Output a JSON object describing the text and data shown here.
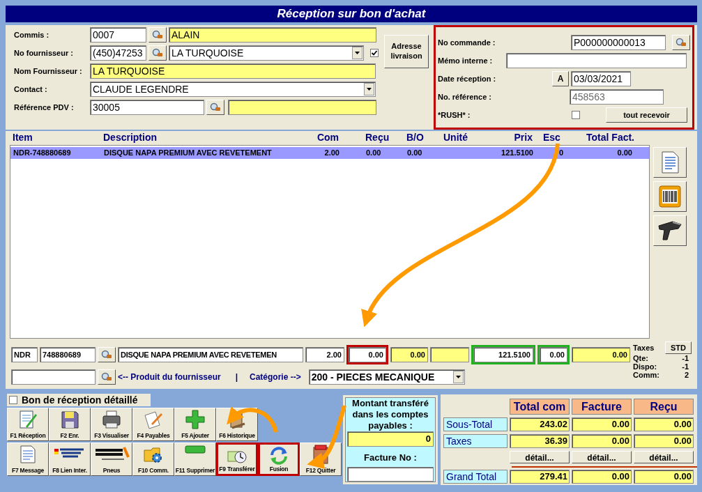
{
  "window": {
    "title": "Réception sur bon d'achat"
  },
  "header_form": {
    "commis": {
      "label": "Commis :",
      "code": "0007",
      "name": "ALAIN"
    },
    "supplier_no": {
      "label": "No fournisseur :",
      "code": "(450)47253",
      "name": "LA TURQUOISE",
      "checked": true
    },
    "supplier_name": {
      "label": "Nom Fournisseur :",
      "value": "LA TURQUOISE"
    },
    "contact": {
      "label": "Contact :",
      "value": "CLAUDE LEGENDRE"
    },
    "pdv_ref": {
      "label": "Référence PDV :",
      "code": "30005"
    },
    "address_button": "Adresse livraison"
  },
  "order_panel": {
    "highlighted": true,
    "order_no": {
      "label": "No commande :",
      "value": "P000000000013"
    },
    "memo": {
      "label": "Mémo interne :"
    },
    "reception_date": {
      "label": "Date réception :",
      "button": "A",
      "value": "03/03/2021"
    },
    "reference": {
      "label": "No. référence :",
      "value": "458563"
    },
    "rush": {
      "label": "*RUSH* :",
      "checked": false
    },
    "receive_all_button": "tout recevoir"
  },
  "table": {
    "columns": [
      "Item",
      "Description",
      "Com",
      "Reçu",
      "B/O",
      "Unité",
      "Prix",
      "Esc",
      "Total Fact."
    ],
    "rows": [
      {
        "selected": true,
        "cells": [
          "NDR-748880689",
          "DISQUE NAPA PREMIUM AVEC REVETEMENT",
          "2.00",
          "0.00",
          "0.00",
          null,
          "121.5100",
          "0",
          "0.00"
        ]
      }
    ]
  },
  "line_edit": {
    "prefix": "NDR",
    "code": "748880689",
    "description": "DISQUE NAPA PREMIUM AVEC REVETEMEN",
    "fields": [
      {
        "value": "2.00",
        "kind": "white"
      },
      {
        "value": "0.00",
        "kind": "white",
        "color": "#c00000"
      },
      {
        "value": "0.00",
        "kind": "yellow"
      },
      {
        "kind": "yellow"
      },
      {
        "value": "121.5100",
        "kind": "white",
        "color": "#22b022"
      },
      {
        "value": "0.00",
        "kind": "white",
        "color": "#22b022"
      },
      {
        "value": "0.00",
        "kind": "yellow"
      }
    ],
    "supplier_product_link": "<-- Produit du fournisseur",
    "separator": "|",
    "category_label": "Catégorie -->",
    "category": "200 - PIECES MECANIQUE"
  },
  "stats": {
    "taxes_label": "Taxes",
    "std_button": "STD",
    "lines": [
      {
        "label": "Qte:",
        "value": "-1"
      },
      {
        "label": "Dispo:",
        "value": "-1"
      },
      {
        "label": "Comm:",
        "value": "2"
      }
    ]
  },
  "detailed_checkbox": {
    "label": "Bon de réception détaillé",
    "checked": false
  },
  "toolbar": [
    [
      {
        "label": "F1 Réception",
        "kind": "notepad",
        "highlighted": false
      },
      {
        "label": "F2 Enr.",
        "kind": "floppy",
        "highlighted": false
      },
      {
        "label": "F3 Visualiser",
        "kind": "printer",
        "highlighted": false
      },
      {
        "label": "F4 Payables",
        "kind": "paper",
        "highlighted": false
      },
      {
        "label": "F5 Ajouter",
        "kind": "plus",
        "highlighted": false
      },
      {
        "label": "F6 Historique",
        "kind": "book",
        "highlighted": false
      }
    ],
    [
      {
        "label": "F7 Message",
        "kind": "document",
        "highlighted": false
      },
      {
        "label": "F8 Lien Inter.",
        "kind": "logo",
        "highlighted": false
      },
      {
        "label": "Pneus",
        "kind": "logo2",
        "highlighted": false
      },
      {
        "label": "F10 Comm.",
        "kind": "folder",
        "highlighted": false
      },
      {
        "label": "F11 Supprimer",
        "kind": "minus",
        "highlighted": false
      },
      {
        "label": "F9 Transférer",
        "kind": "clock",
        "highlighted": true
      },
      {
        "label": "Fusion",
        "kind": "cycle",
        "highlighted": true
      },
      {
        "label": "F12 Quitter",
        "kind": "door",
        "highlighted": false
      }
    ]
  ],
  "transfer": {
    "label": "Montant transféré dans les comptes payables :",
    "value": "0",
    "invoice_label": "Facture No :"
  },
  "totals": {
    "columns": [
      "Total com",
      "Facture",
      "Reçu"
    ],
    "rows": [
      {
        "label": "Sous-Total",
        "values": [
          "243.02",
          "0.00",
          "0.00"
        ]
      },
      {
        "label": "Taxes",
        "values": [
          "36.39",
          "0.00",
          "0.00"
        ]
      }
    ],
    "detail_buttons": [
      "détail...",
      "détail...",
      "détail..."
    ],
    "grand_total": {
      "label": "Grand Total",
      "values": [
        "279.41",
        "0.00",
        "0.00"
      ]
    }
  }
}
